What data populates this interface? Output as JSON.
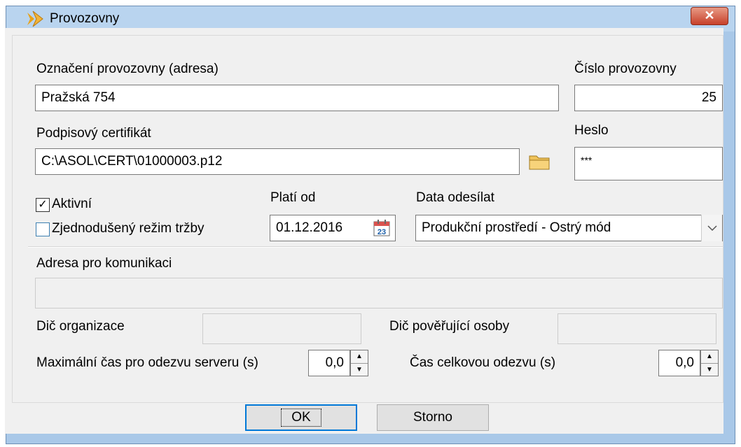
{
  "window": {
    "title": "Provozovny",
    "close_glyph": "✕"
  },
  "form": {
    "designation": {
      "label": "Označení provozovny (adresa)",
      "value": "Pražská 754"
    },
    "number": {
      "label": "Číslo provozovny",
      "value": "25"
    },
    "certificate": {
      "label": "Podpisový certifikát",
      "value": "C:\\ASOL\\CERT\\01000003.p12"
    },
    "password": {
      "label": "Heslo",
      "value": "***"
    },
    "active": {
      "label": "Aktivní",
      "checked": true,
      "mark": "✓"
    },
    "simplified": {
      "label": "Zjednodušený režim tržby",
      "checked": false
    },
    "valid_from": {
      "label": "Platí od",
      "value": "01.12.2016",
      "calendar_day": "23"
    },
    "send_data": {
      "label": "Data odesílat",
      "value": "Produkční prostředí - Ostrý mód"
    },
    "comm_address": {
      "label": "Adresa pro komunikaci",
      "value": ""
    },
    "org_dic": {
      "label": "Dič organizace",
      "value": ""
    },
    "auth_dic": {
      "label": "Dič pověřující osoby",
      "value": ""
    },
    "max_server_time": {
      "label": "Maximální čas pro odezvu serveru (s)",
      "value": "0,0"
    },
    "total_time": {
      "label": "Čas celkovou odezvu (s)",
      "value": "0,0"
    }
  },
  "buttons": {
    "ok": "OK",
    "cancel": "Storno"
  },
  "colors": {
    "titlebar": "#b9d4ef",
    "close": "#c7402a",
    "focus": "#0078d7",
    "checkbox_accent": "#3c7fb1"
  },
  "icons": {
    "app": "arrows-app-icon",
    "browse": "folder-icon",
    "calendar": "calendar-icon",
    "dropdown": "chevron-down-icon",
    "spin_up": "spin-up-icon",
    "spin_down": "spin-down-icon"
  },
  "spin": {
    "up": "▲",
    "down": "▼"
  }
}
